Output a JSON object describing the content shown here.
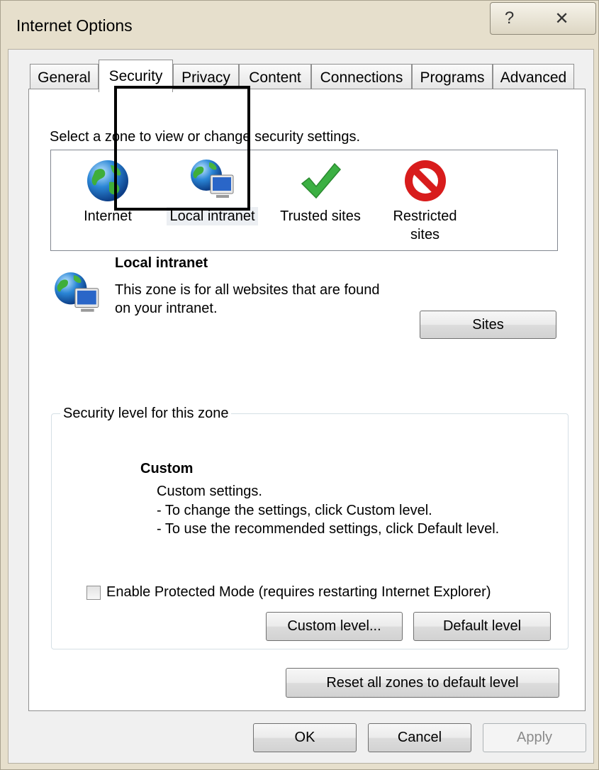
{
  "window": {
    "title": "Internet Options",
    "help_glyph": "?",
    "close_glyph": "✕"
  },
  "tabs": [
    {
      "label": "General"
    },
    {
      "label": "Security"
    },
    {
      "label": "Privacy"
    },
    {
      "label": "Content"
    },
    {
      "label": "Connections"
    },
    {
      "label": "Programs"
    },
    {
      "label": "Advanced"
    }
  ],
  "active_tab": "Security",
  "security": {
    "zone_prompt": "Select a zone to view or change security settings.",
    "zones": [
      {
        "label": "Internet",
        "icon": "globe-icon"
      },
      {
        "label": "Local intranet",
        "icon": "intranet-icon"
      },
      {
        "label": "Trusted sites",
        "icon": "checkmark-icon"
      },
      {
        "label": "Restricted sites",
        "icon": "restricted-icon"
      }
    ],
    "selected_zone": "Local intranet",
    "detail": {
      "title": "Local intranet",
      "description": "This zone is for all websites that are found on your intranet.",
      "sites_button": "Sites"
    },
    "level_group": {
      "legend": "Security level for this zone",
      "level_name": "Custom",
      "level_lines": [
        "Custom settings.",
        "- To change the settings, click Custom level.",
        "- To use the recommended settings, click Default level."
      ],
      "protected_mode_label": "Enable Protected Mode (requires restarting Internet Explorer)",
      "protected_mode_checked": false,
      "custom_level_button": "Custom level...",
      "default_level_button": "Default level"
    },
    "reset_button": "Reset all zones to default level"
  },
  "footer": {
    "ok": "OK",
    "cancel": "Cancel",
    "apply": "Apply",
    "apply_enabled": false
  },
  "colors": {
    "window_frame": "#e6dfcc",
    "dialog_bg": "#f0f0f0",
    "panel_bg": "#ffffff",
    "highlight_border": "#000000"
  }
}
